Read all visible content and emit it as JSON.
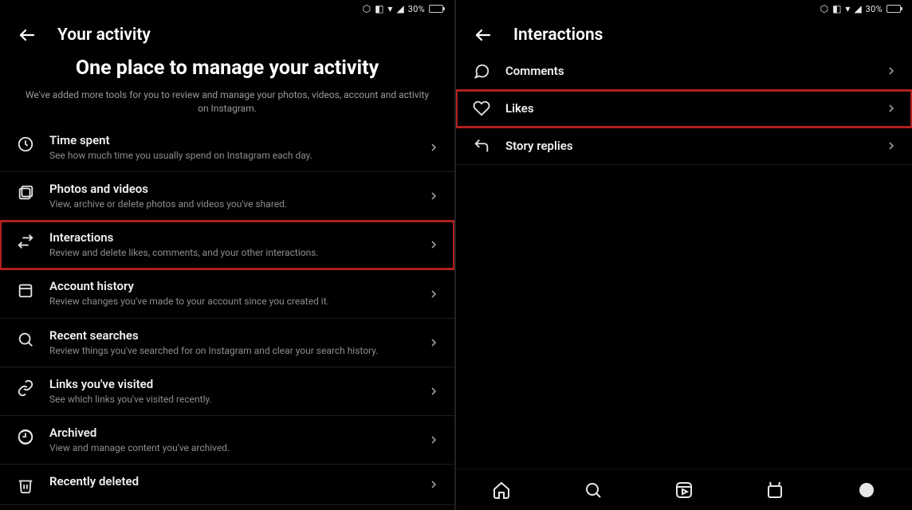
{
  "status": {
    "battery_text": "30%"
  },
  "left": {
    "header_title": "Your activity",
    "hero_title": "One place to manage your activity",
    "hero_sub": "We've added more tools for you to review and manage your photos, videos, account and activity on Instagram.",
    "items": [
      {
        "title": "Time spent",
        "sub": "See how much time you usually spend on Instagram each day."
      },
      {
        "title": "Photos and videos",
        "sub": "View, archive or delete photos and videos you've shared."
      },
      {
        "title": "Interactions",
        "sub": "Review and delete likes, comments, and your other interactions."
      },
      {
        "title": "Account history",
        "sub": "Review changes you've made to your account since you created it."
      },
      {
        "title": "Recent searches",
        "sub": "Review things you've searched for on Instagram and clear your search history."
      },
      {
        "title": "Links you've visited",
        "sub": "See which links you've visited recently."
      },
      {
        "title": "Archived",
        "sub": "View and manage content you've archived."
      },
      {
        "title": "Recently deleted",
        "sub": ""
      }
    ]
  },
  "right": {
    "header_title": "Interactions",
    "items": [
      {
        "title": "Comments"
      },
      {
        "title": "Likes"
      },
      {
        "title": "Story replies"
      }
    ]
  }
}
